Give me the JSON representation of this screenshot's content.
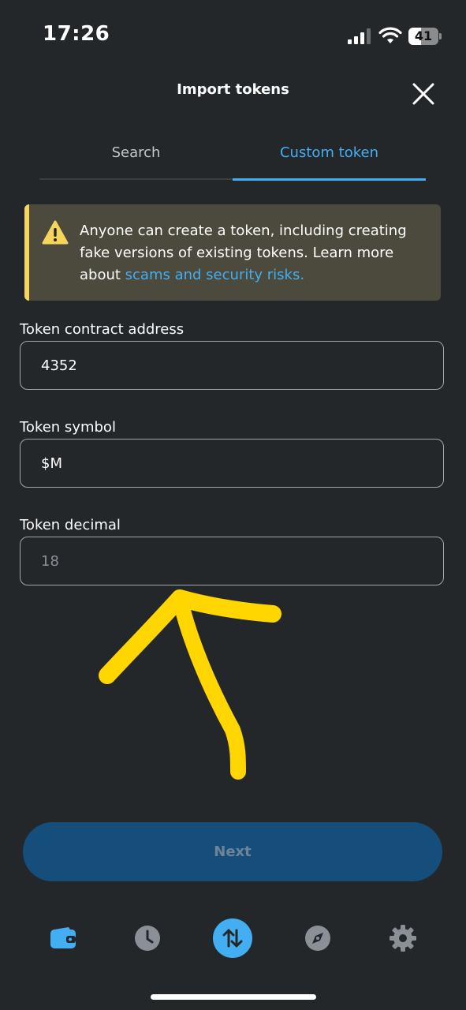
{
  "status_bar": {
    "time": "17:26",
    "battery_level": "41",
    "battery_fraction": 0.41
  },
  "header": {
    "title": "Import tokens"
  },
  "tabs": [
    {
      "label": "Search",
      "active": false
    },
    {
      "label": "Custom token",
      "active": true
    }
  ],
  "warning": {
    "text": "Anyone can create a token, including creating fake versions of existing tokens. Learn more about ",
    "link_text": "scams and security risks."
  },
  "form": {
    "address_label": "Token contract address",
    "address_value": "4352",
    "symbol_label": "Token symbol",
    "symbol_value": "$M",
    "decimal_label": "Token decimal",
    "decimal_placeholder": "18"
  },
  "next_label": "Next",
  "bottom_nav": [
    {
      "icon": "wallet-icon",
      "active": true
    },
    {
      "icon": "clock-icon",
      "active": false
    },
    {
      "icon": "swap-icon",
      "active": false
    },
    {
      "icon": "compass-icon",
      "active": false
    },
    {
      "icon": "gear-icon",
      "active": false
    }
  ],
  "colors": {
    "background": "#24272a",
    "accent": "#43aef2",
    "warning_bg": "#4b4a3d",
    "warning_bar": "#f6d55c",
    "button_bg": "#154e7a",
    "annotation": "#ffd600"
  }
}
